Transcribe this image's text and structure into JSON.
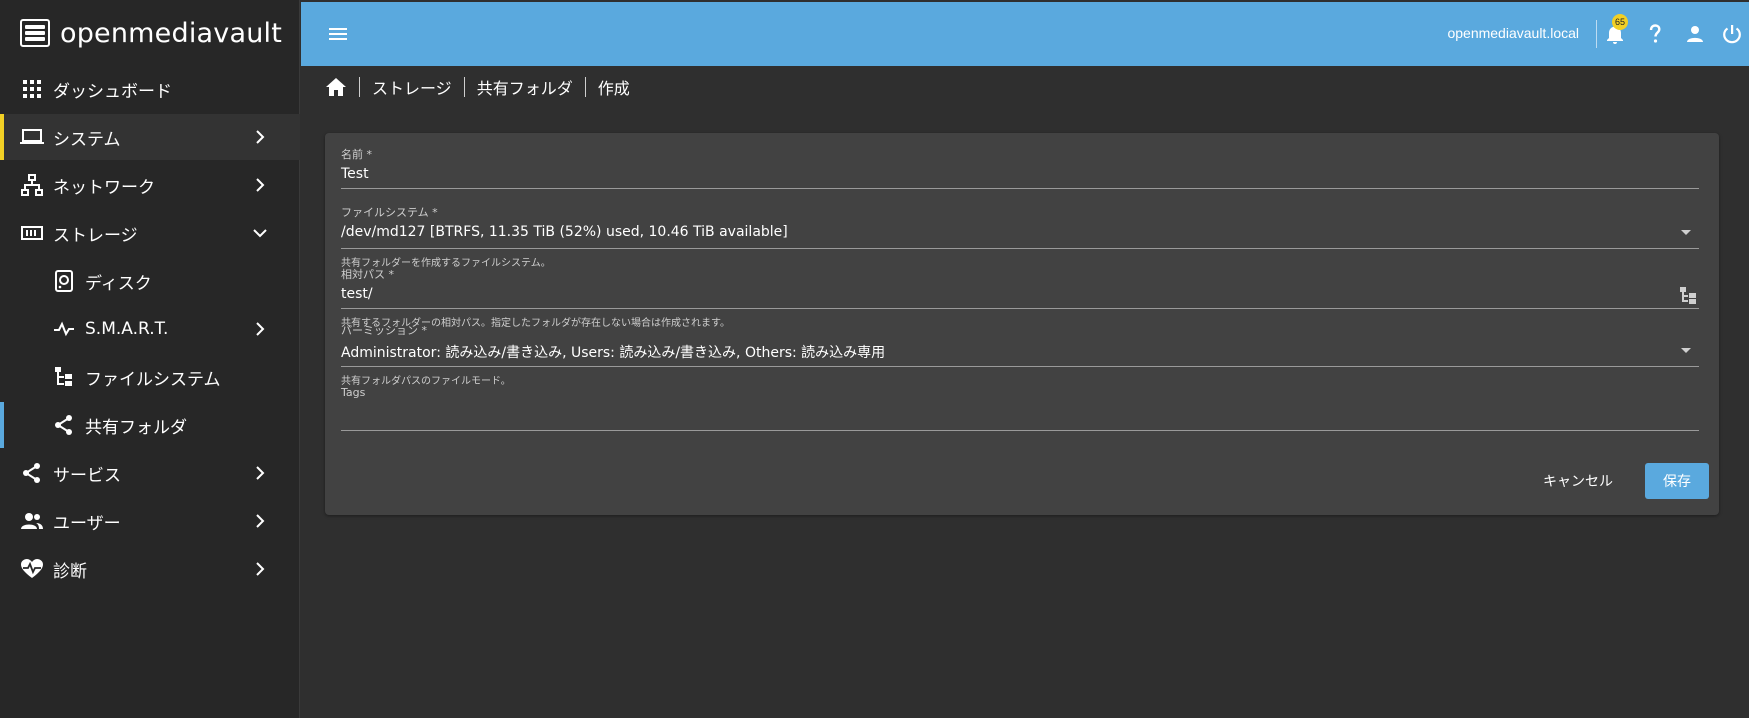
{
  "app": {
    "title": "openmediavault"
  },
  "topbar": {
    "hostname": "openmediavault.local",
    "notification_count": "65"
  },
  "sidebar": {
    "items": [
      {
        "label": "ダッシュボード"
      },
      {
        "label": "システム"
      },
      {
        "label": "ネットワーク"
      },
      {
        "label": "ストレージ"
      },
      {
        "label": "ディスク"
      },
      {
        "label": "S.M.A.R.T."
      },
      {
        "label": "ファイルシステム"
      },
      {
        "label": "共有フォルダ"
      },
      {
        "label": "サービス"
      },
      {
        "label": "ユーザー"
      },
      {
        "label": "診断"
      }
    ]
  },
  "breadcrumb": {
    "items": [
      "ストレージ",
      "共有フォルダ",
      "作成"
    ]
  },
  "form": {
    "name": {
      "label": "名前 *",
      "value": "Test"
    },
    "filesystem": {
      "label": "ファイルシステム *",
      "value": "/dev/md127 [BTRFS, 11.35 TiB (52%) used, 10.46 TiB available]",
      "hint": "共有フォルダーを作成するファイルシステム。"
    },
    "relpath": {
      "label": "相対パス *",
      "value": "test/",
      "hint": "共有するフォルダーの相対パス。指定したフォルダが存在しない場合は作成されます。"
    },
    "permissions": {
      "label": "パーミッション *",
      "value": "Administrator: 読み込み/書き込み, Users: 読み込み/書き込み, Others: 読み込み専用",
      "hint": "共有フォルダパスのファイルモード。"
    },
    "tags": {
      "label": "Tags",
      "value": ""
    },
    "cancel_label": "キャンセル",
    "save_label": "保存"
  },
  "colors": {
    "accent": "#5aa9de",
    "active_marker_system": "#f2d025",
    "active_marker_shared": "#5aa9de"
  }
}
